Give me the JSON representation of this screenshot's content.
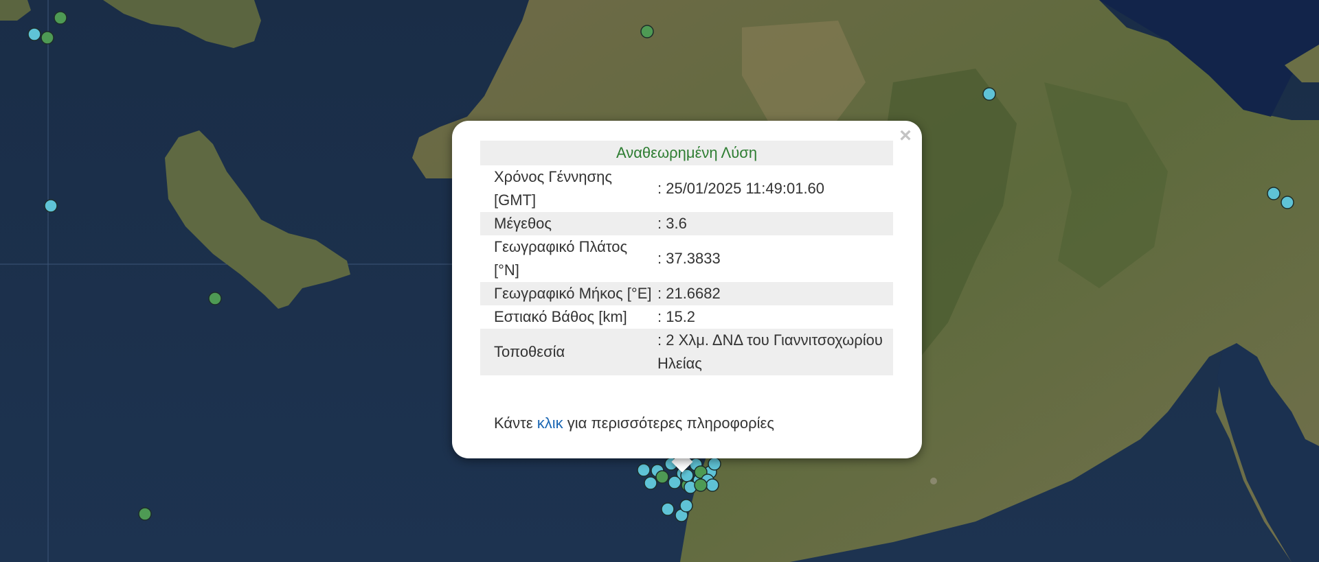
{
  "popup": {
    "status": "Αναθεωρημένη Λύση",
    "close_symbol": "×",
    "rows": [
      {
        "label": "Χρόνος Γέννησης [GMT]",
        "value": ": 25/01/2025 11:49:01.60"
      },
      {
        "label": "Μέγεθος",
        "value": ": 3.6"
      },
      {
        "label": "Γεωγραφικό Πλάτος [°N]",
        "value": ": 37.3833"
      },
      {
        "label": "Γεωγραφικό Μήκος [°E]",
        "value": ": 21.6682"
      },
      {
        "label": "Εστιακό Βάθος [km]",
        "value": ": 15.2"
      },
      {
        "label": "Τοποθεσία",
        "value": ": 2 Χλμ. ΔΝΔ του Γιαννιτσοχωρίου Ηλείας"
      }
    ],
    "footer": {
      "prefix": "Κάντε",
      "link": "κλικ",
      "suffix": "για περισσότερες πληροφορίες"
    }
  },
  "colors": {
    "marker_cyan": "#5fc3d6",
    "marker_green": "#4e9a54",
    "status_green": "#2e7d32",
    "link_blue": "#1a66b3"
  },
  "icons": {
    "close": "close-icon"
  }
}
